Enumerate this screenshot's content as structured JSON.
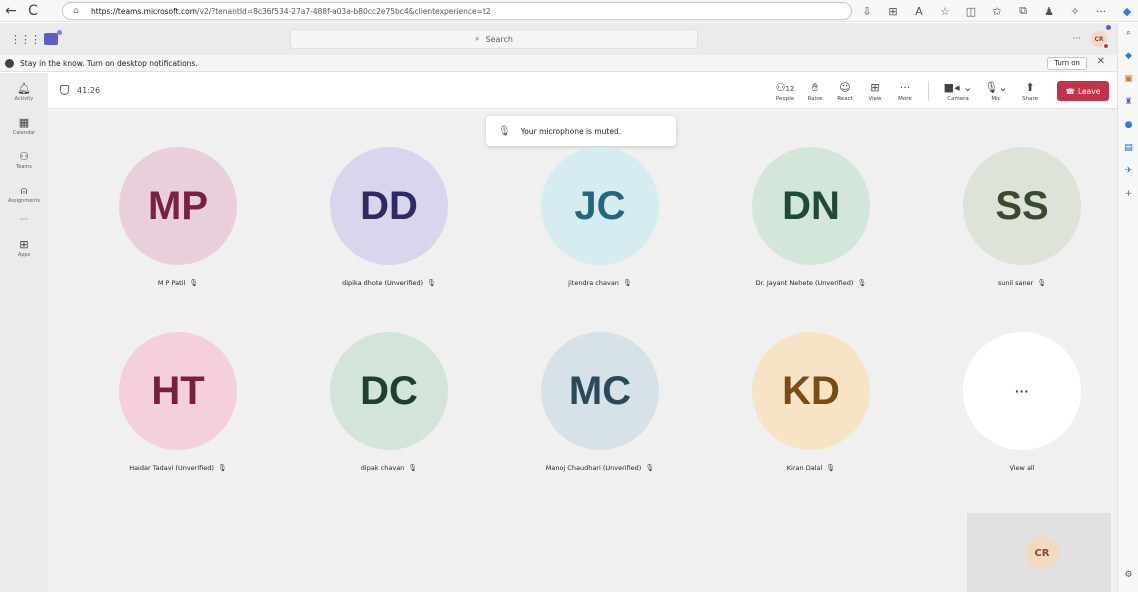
{
  "browser": {
    "url_host": "https://teams.microsoft.com",
    "url_path": "/v2/?tenantId=8c36f534-27a7-488f-a03a-b80cc2e75bc4&clientexperience=t2",
    "back_icon": "←",
    "refresh_icon": "C",
    "lock_icon": "🔒"
  },
  "header": {
    "search_placeholder": "Search",
    "more_label": "···",
    "avatar_initials": "CR"
  },
  "banner": {
    "message": "Stay in the know. Turn on desktop notifications.",
    "turn_on_label": "Turn on",
    "close_label": "✕"
  },
  "rail": {
    "items": [
      {
        "icon": "🔔",
        "label": "Activity"
      },
      {
        "icon": "▦",
        "label": "Calendar"
      },
      {
        "icon": "👥",
        "label": "Teams"
      },
      {
        "icon": "🎒",
        "label": "Assignments"
      }
    ],
    "more": "···",
    "apps": {
      "icon": "⊞",
      "label": "Apps"
    }
  },
  "meeting": {
    "timer": "41:26",
    "tools": {
      "people_count": "12",
      "people": "People",
      "raise": "Raise",
      "react": "React",
      "view": "View",
      "more": "More",
      "camera": "Camera",
      "mic": "Mic",
      "share": "Share",
      "leave": "Leave"
    },
    "toast": "Your microphone is muted."
  },
  "participants": [
    {
      "initials": "MP",
      "name": "M P Patil",
      "bg": "#e9cfdc",
      "fg": "#7a1f45"
    },
    {
      "initials": "DD",
      "name": "dipika dhote (Unverified)",
      "bg": "#d9d5ec",
      "fg": "#2e2a63"
    },
    {
      "initials": "JC",
      "name": "jitendra chavan",
      "bg": "#d6ecf0",
      "fg": "#1f6a7a"
    },
    {
      "initials": "DN",
      "name": "Dr. Jayant Nehete (Unverified)",
      "bg": "#d3e6da",
      "fg": "#1f4a33"
    },
    {
      "initials": "SS",
      "name": "sunil saner",
      "bg": "#dde3d8",
      "fg": "#3b4a2e"
    },
    {
      "initials": "HT",
      "name": "Haidar Tadavi (Unverified)",
      "bg": "#f4d0dc",
      "fg": "#7a1f3a"
    },
    {
      "initials": "DC",
      "name": "dipak chavan",
      "bg": "#d3e4d9",
      "fg": "#1f4030"
    },
    {
      "initials": "MC",
      "name": "Manoj Chaudhari (Unverified)",
      "bg": "#d6e2e8",
      "fg": "#2a4a5a"
    },
    {
      "initials": "KD",
      "name": "Kiran Dalal",
      "bg": "#f7e4c4",
      "fg": "#7a4b12"
    },
    {
      "initials": "···",
      "name": "View all",
      "bg": "#ffffff",
      "fg": "#424242"
    }
  ],
  "self_view": {
    "initials": "CR"
  }
}
